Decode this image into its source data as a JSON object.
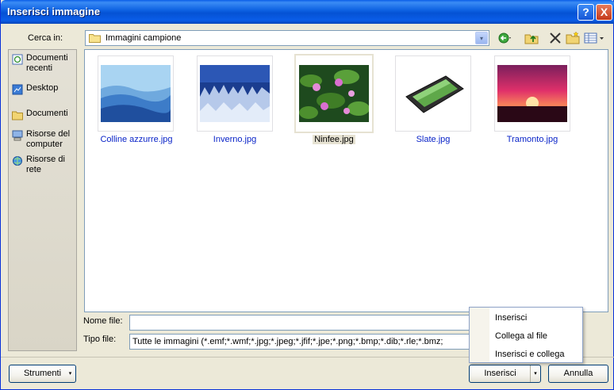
{
  "window": {
    "title": "Inserisci immagine",
    "help_label": "?",
    "close_label": "X"
  },
  "lookin": {
    "label": "Cerca in:",
    "value": "Immagini campione",
    "dropdown_glyph": "▾"
  },
  "toolbar": [
    "back-icon",
    "up-folder-icon",
    "delete-icon",
    "new-folder-icon",
    "views-icon"
  ],
  "places": [
    {
      "label": "Documenti recenti",
      "icon": "recent-docs-icon"
    },
    {
      "label": "Desktop",
      "icon": "desktop-icon"
    },
    {
      "label": "Documenti",
      "icon": "documents-icon"
    },
    {
      "label": "Risorse del computer",
      "icon": "my-computer-icon"
    },
    {
      "label": "Risorse di rete",
      "icon": "network-icon"
    }
  ],
  "files": [
    {
      "name": "Colline azzurre.jpg"
    },
    {
      "name": "Inverno.jpg"
    },
    {
      "name": "Ninfee.jpg",
      "selected": true
    },
    {
      "name": "Slate.jpg"
    },
    {
      "name": "Tramonto.jpg"
    }
  ],
  "filename": {
    "label": "Nome file:",
    "value": ""
  },
  "filetype": {
    "label": "Tipo file:",
    "value": "Tutte le immagini (*.emf;*.wmf;*.jpg;*.jpeg;*.jfif;*.jpe;*.png;*.bmp;*.dib;*.rle;*.bmz;"
  },
  "buttons": {
    "tools": "Strumenti",
    "insert": "Inserisci",
    "cancel": "Annulla",
    "arrow": "▾"
  },
  "insert_menu": [
    "Inserisci",
    "Collega al file",
    "Inserisci e collega"
  ],
  "colors": {
    "title_bar": "#0a5de8",
    "link_text": "#0a24c8",
    "selection": "#e6e2d2"
  }
}
